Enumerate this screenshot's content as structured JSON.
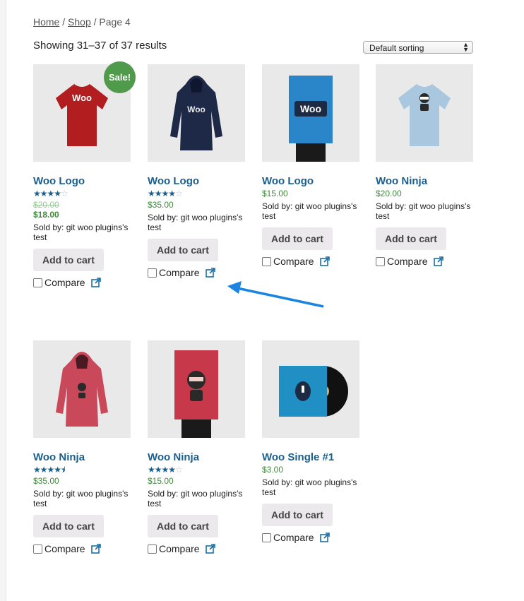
{
  "breadcrumb": {
    "home": "Home",
    "shop": "Shop",
    "current": "Page 4"
  },
  "results_text": "Showing 31–37 of 37 results",
  "sort": {
    "selected": "Default sorting"
  },
  "colors": {
    "title": "#1a5f8c",
    "price": "#3f8a3a",
    "sale": "#4f9a4b",
    "button": "#ebe9eb"
  },
  "products": [
    {
      "title": "Woo Logo",
      "rating": 4,
      "old_price": "$20.00",
      "price": "$18.00",
      "sale": "Sale!",
      "seller": "Sold by: git woo plugins's test",
      "button": "Add to cart",
      "compare": "Compare",
      "image": "red-tshirt"
    },
    {
      "title": "Woo Logo",
      "rating": 4,
      "price": "$35.00",
      "seller": "Sold by: git woo plugins's test",
      "button": "Add to cart",
      "compare": "Compare",
      "image": "navy-hoodie"
    },
    {
      "title": "Woo Logo",
      "price": "$15.00",
      "seller": "Sold by: git woo plugins's test",
      "button": "Add to cart",
      "compare": "Compare",
      "image": "blue-poster"
    },
    {
      "title": "Woo Ninja",
      "price": "$20.00",
      "seller": "Sold by: git woo plugins's test",
      "button": "Add to cart",
      "compare": "Compare",
      "image": "light-blue-tshirt"
    },
    {
      "title": "Woo Ninja",
      "rating": 4.5,
      "price": "$35.00",
      "seller": "Sold by: git woo plugins's test",
      "button": "Add to cart",
      "compare": "Compare",
      "image": "red-hoodie"
    },
    {
      "title": "Woo Ninja",
      "rating": 4,
      "price": "$15.00",
      "seller": "Sold by: git woo plugins's test",
      "button": "Add to cart",
      "compare": "Compare",
      "image": "ninja-poster"
    },
    {
      "title": "Woo Single #1",
      "price": "$3.00",
      "seller": "Sold by: git woo plugins's test",
      "button": "Add to cart",
      "compare": "Compare",
      "image": "vinyl-record"
    }
  ]
}
